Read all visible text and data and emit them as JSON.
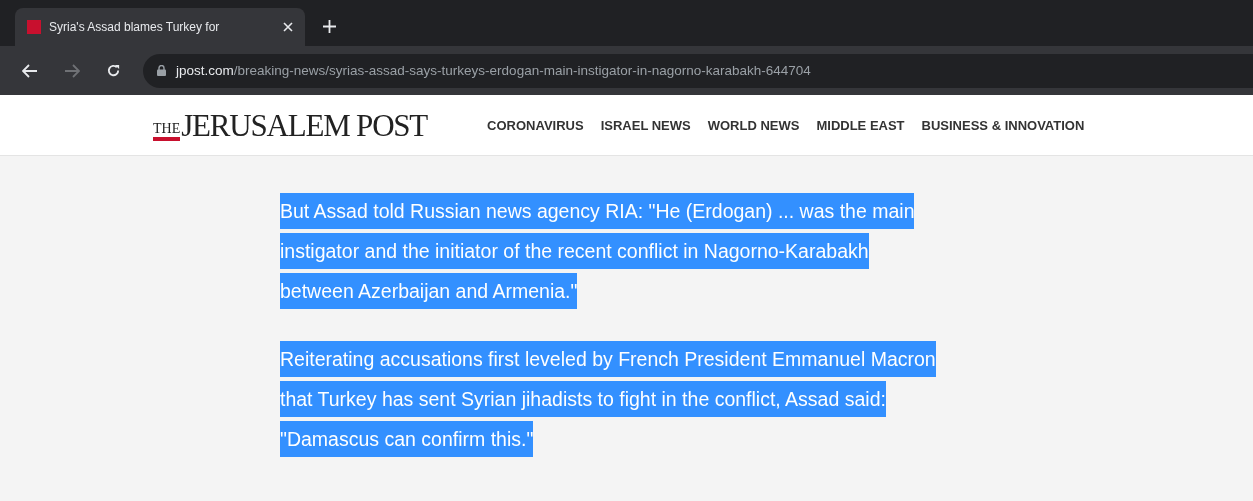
{
  "browser": {
    "tab": {
      "title": "Syria's Assad blames Turkey for",
      "selected": true
    },
    "url": {
      "domain": "jpost.com",
      "path": "/breaking-news/syrias-assad-says-turkeys-erdogan-main-instigator-in-nagorno-karabakh-644704"
    }
  },
  "site": {
    "logo": {
      "small": "THE",
      "main": "JERUSALEM POST"
    },
    "nav": [
      "CORONAVIRUS",
      "ISRAEL NEWS",
      "WORLD NEWS",
      "MIDDLE EAST",
      "BUSINESS & INNOVATION"
    ]
  },
  "article": {
    "paragraphs": [
      {
        "selected": true,
        "lines": [
          "But Assad told Russian news agency RIA: \"He (Erdogan) ... was the main",
          "instigator and the initiator of the recent conflict in Nagorno-Karabakh",
          "between Azerbaijan and Armenia.\""
        ]
      },
      {
        "selected": true,
        "lines": [
          "Reiterating accusations first leveled by French President Emmanuel Macron",
          "that Turkey has sent Syrian jihadists to fight in the conflict, Assad said:",
          "\"Damascus can confirm this.\""
        ]
      }
    ]
  }
}
